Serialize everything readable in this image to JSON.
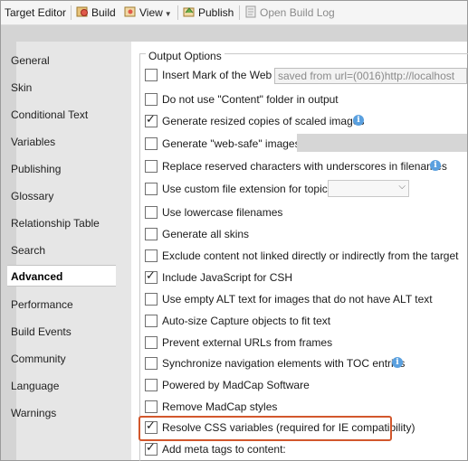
{
  "toolbar": {
    "title": "Target Editor",
    "build": "Build",
    "view": "View",
    "publish": "Publish",
    "open_build_log": "Open Build Log"
  },
  "tabs": [
    {
      "label": "General"
    },
    {
      "label": "Skin"
    },
    {
      "label": "Conditional Text"
    },
    {
      "label": "Variables"
    },
    {
      "label": "Publishing"
    },
    {
      "label": "Glossary"
    },
    {
      "label": "Relationship Table"
    },
    {
      "label": "Search"
    },
    {
      "label": "Advanced",
      "active": true
    },
    {
      "label": "Performance"
    },
    {
      "label": "Build Events"
    },
    {
      "label": "Community"
    },
    {
      "label": "Language"
    },
    {
      "label": "Warnings"
    }
  ],
  "output_options": {
    "group_label": "Output Options",
    "mark_of_web_value": "saved from url=(0016)http://localhost",
    "options": [
      {
        "label": "Insert Mark of the Web",
        "checked": false
      },
      {
        "label": "Do not use \"Content\" folder in output",
        "checked": false
      },
      {
        "label": "Generate resized copies of scaled images",
        "checked": true,
        "info": true
      },
      {
        "label": "Generate \"web-safe\" images",
        "checked": false
      },
      {
        "label": "Replace reserved characters with underscores in filenames",
        "checked": false,
        "info": true
      },
      {
        "label": "Use custom file extension for topics",
        "checked": false
      },
      {
        "label": "Use lowercase filenames",
        "checked": false
      },
      {
        "label": "Generate all skins",
        "checked": false
      },
      {
        "label": "Exclude content not linked directly or indirectly from the target",
        "checked": false
      },
      {
        "label": "Include JavaScript for CSH",
        "checked": true
      },
      {
        "label": "Use empty ALT text for images that do not have ALT text",
        "checked": false
      },
      {
        "label": "Auto-size Capture objects to fit text",
        "checked": false
      },
      {
        "label": "Prevent external URLs from frames",
        "checked": false
      },
      {
        "label": "Synchronize navigation elements with TOC entries",
        "checked": false,
        "info": true
      },
      {
        "label": "Powered by MadCap Software",
        "checked": false
      },
      {
        "label": "Remove MadCap styles",
        "checked": false
      },
      {
        "label": "Resolve CSS variables (required for IE compatibility)",
        "checked": true
      },
      {
        "label": "Add meta tags to content:",
        "checked": true
      }
    ]
  },
  "colors": {
    "highlight": "#d2572c",
    "info": "#5aa0df"
  }
}
